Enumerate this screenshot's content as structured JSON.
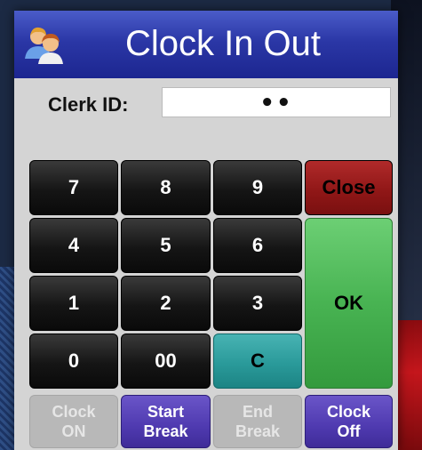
{
  "window": {
    "title": "Clock In Out"
  },
  "clerk": {
    "label": "Clerk ID:",
    "value": "••"
  },
  "keypad": {
    "digits": [
      "7",
      "8",
      "9",
      "4",
      "5",
      "6",
      "1",
      "2",
      "3",
      "0",
      "00"
    ],
    "clear": "C",
    "close": "Close",
    "ok": "OK"
  },
  "actions": {
    "clock_on": [
      "Clock",
      "ON"
    ],
    "start_break": [
      "Start",
      "Break"
    ],
    "end_break": [
      "End",
      "Break"
    ],
    "clock_off": [
      "Clock",
      "Off"
    ]
  },
  "colors": {
    "titlebar": "#2b37a6",
    "close": "#8e1616",
    "ok": "#48b352",
    "clear": "#2a9a9a",
    "action": "#4f3ab0",
    "disabled": "#b8b8b8"
  }
}
